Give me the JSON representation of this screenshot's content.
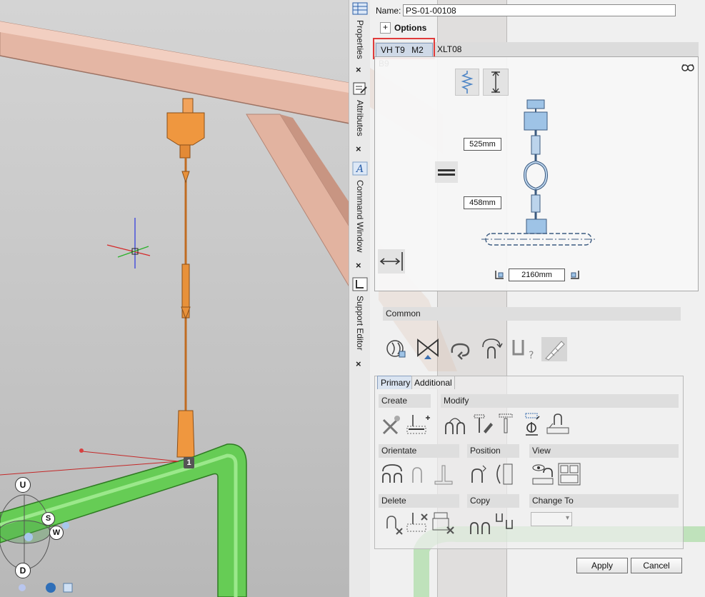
{
  "dock": {
    "tabs": [
      {
        "label": "Properties",
        "icon": "table-icon"
      },
      {
        "label": "Attributes",
        "icon": "attributes-icon"
      },
      {
        "label": "Command Window",
        "icon": "command-icon"
      },
      {
        "label": "Support Editor",
        "icon": "support-editor-icon"
      }
    ],
    "close_glyph": "×"
  },
  "editor": {
    "name_label": "Name:",
    "name_value": "PS-01-00108",
    "options_toggle": "+",
    "options_label": "Options",
    "support_tabs": [
      {
        "parts": [
          "VH T9",
          "M2 B9"
        ],
        "active": true
      },
      {
        "label": "XLT08",
        "active": false
      }
    ],
    "dimensions": {
      "upper": "525mm",
      "lower": "458mm",
      "length": "2160mm"
    },
    "common_header": "Common",
    "panel_tabs": [
      "Primary",
      "Additional"
    ],
    "sections": {
      "create": "Create",
      "modify": "Modify",
      "orientate": "Orientate",
      "position": "Position",
      "view": "View",
      "delete": "Delete",
      "copy": "Copy",
      "change_to": "Change To"
    },
    "apply_label": "Apply",
    "cancel_label": "Cancel"
  },
  "viewport": {
    "support_number": "1",
    "compass": {
      "up": "U",
      "down": "D",
      "south": "S",
      "west": "W"
    }
  },
  "colors": {
    "highlight": "#e03b3b",
    "pipe": "#5cc44a",
    "hanger": "#e8913a",
    "beam": "#e9b7a4",
    "part_blue": "#9ec3e6"
  }
}
